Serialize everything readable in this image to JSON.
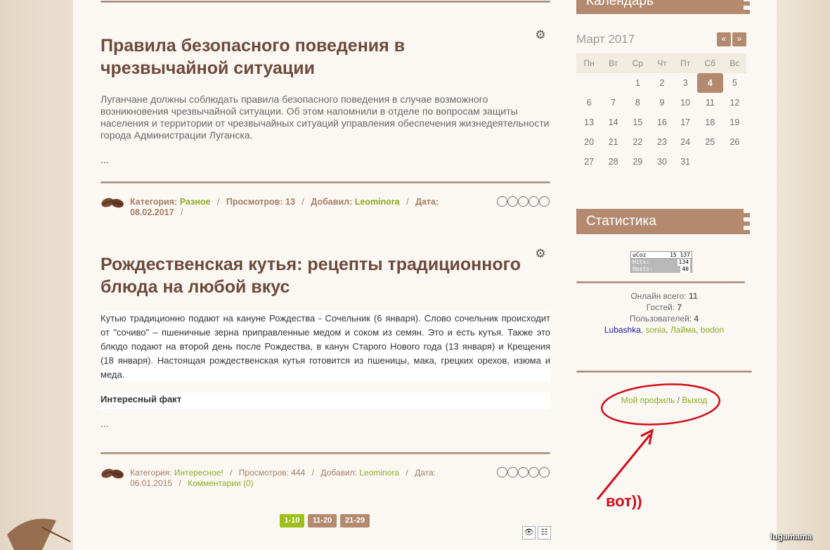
{
  "posts": [
    {
      "title": "Правила безопасного поведения в чрезвычайной ситуации",
      "excerpt": "Луганчане должны соблюдать правила безопасного поведения в случае возможного возникновения чрезвычайной ситуации. Об этом напомнили в отделе по вопросам защиты населения и территории от чрезвычайных ситуаций управления обеспечения жизнедеятельности города Администрации Луганска.",
      "more": "...",
      "meta": {
        "category_label": "Категория:",
        "category": "Разное",
        "views_label": "Просмотров:",
        "views": "13",
        "added_label": "Добавил:",
        "author": "Leominora",
        "date_label": "Дата:",
        "date": "08.02.2017",
        "trail": "/"
      }
    },
    {
      "title": "Рождественская кутья: рецепты традиционного блюда на любой вкус",
      "excerpt": "Кутью традиционно подают на кануне Рождества - Сочельник (6 января). Слово сочельник происходит от \"сочиво\" – пшеничные зерна приправленные медом и соком из семян. Это и есть кутья.  Также это блюдо подают на второй день после Рождества, в канун Старого Нового года (13 января) и Крещения (18 января). Настоящая рождественская кутья готовится из пшеницы, мака, грецких орехов, изюма и меда.",
      "fact": "Интересный факт",
      "more": "...",
      "meta": {
        "category_label": "Категория:",
        "category": "Интересное!",
        "views_label": "Просмотров:",
        "views": "444",
        "added_label": "Добавил:",
        "author": "Leominora",
        "date_label": "Дата:",
        "date": "06.01.2015",
        "comments": "Комментарии (0)"
      }
    }
  ],
  "pagination": [
    "1-10",
    "11-20",
    "21-29"
  ],
  "calendar": {
    "title": "Календарь",
    "month": "Март 2017",
    "prev": "«",
    "next": "»",
    "weekdays": [
      "Пн",
      "Вт",
      "Ср",
      "Чт",
      "Пт",
      "Сб",
      "Вс"
    ],
    "weeks": [
      [
        "",
        "",
        "1",
        "2",
        "3",
        "4",
        "5"
      ],
      [
        "6",
        "7",
        "8",
        "9",
        "10",
        "11",
        "12"
      ],
      [
        "13",
        "14",
        "15",
        "16",
        "17",
        "18",
        "19"
      ],
      [
        "20",
        "21",
        "22",
        "23",
        "24",
        "25",
        "26"
      ],
      [
        "27",
        "28",
        "29",
        "30",
        "31",
        "",
        ""
      ]
    ],
    "today": "4"
  },
  "stats": {
    "title": "Статистика",
    "counter": {
      "brand": "uCoz",
      "total": "15 137",
      "hits_label": "Hits:",
      "hits": "134",
      "hosts_label": "Hosts:",
      "hosts": "40"
    },
    "online_label": "Онлайн всего:",
    "online": "11",
    "guests_label": "Гостей:",
    "guests": "7",
    "users_label": "Пользователей:",
    "users_count": "4",
    "users": [
      {
        "name": "Lubashka",
        "color": "#1a1aa6"
      },
      {
        "name": "sonia",
        "color": "#8cac1e"
      },
      {
        "name": "Лайма",
        "color": "#8cac1e"
      },
      {
        "name": "bodon",
        "color": "#8cac1e"
      }
    ]
  },
  "profile": {
    "my_profile": "Мой профиль",
    "separator": "/",
    "logout": "Выход"
  },
  "annotation": "вот))",
  "watermark": "lugamama",
  "colors": {
    "accent": "#b38a70",
    "link": "#8cac1e",
    "title": "#6d4a3b",
    "annotation": "#d10d19"
  }
}
